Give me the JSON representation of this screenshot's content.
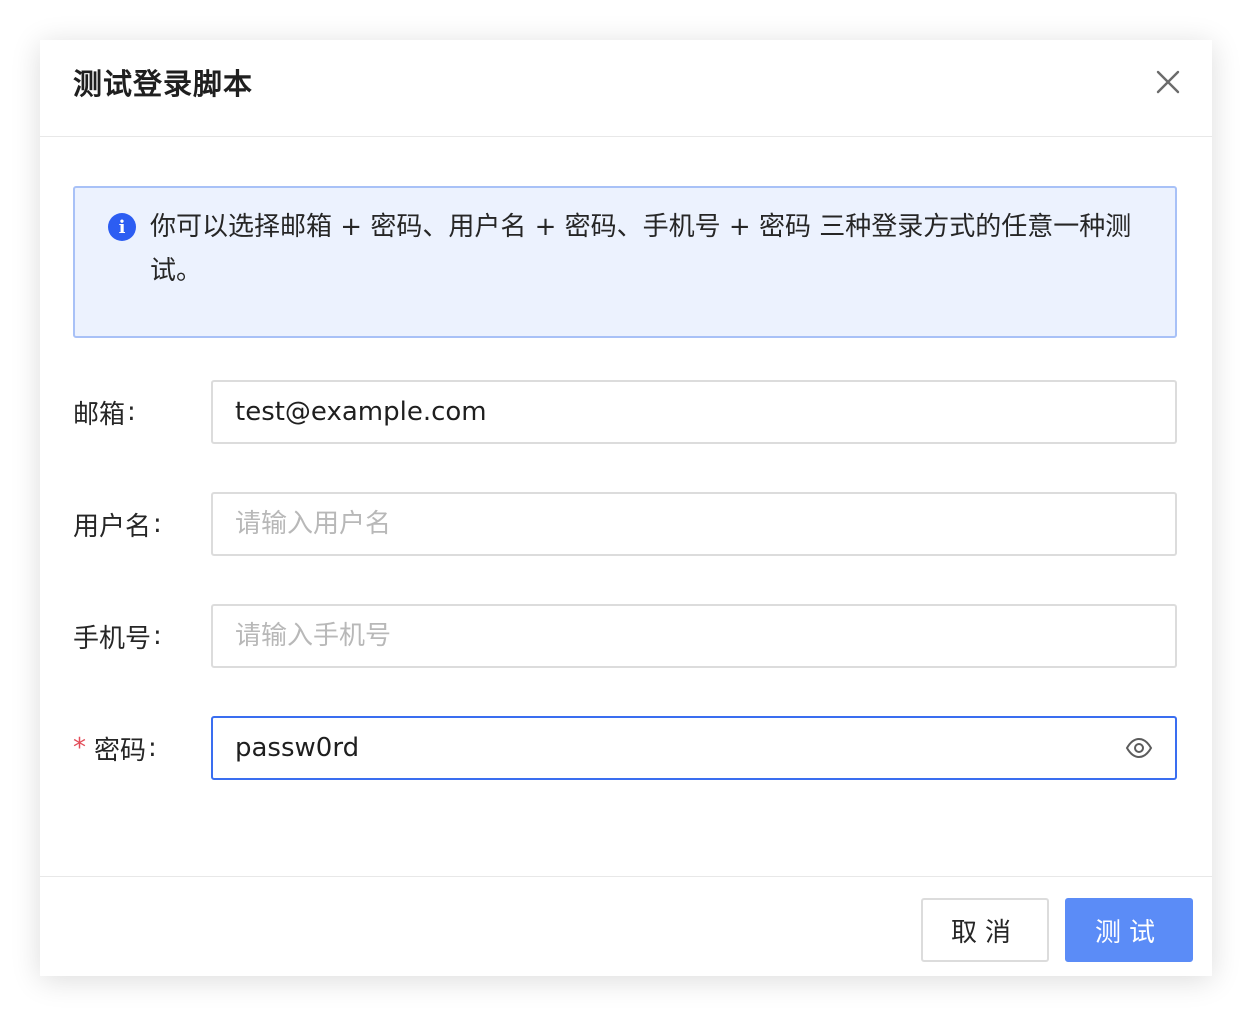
{
  "dialog": {
    "title": "测试登录脚本"
  },
  "alert": {
    "text": "你可以选择邮箱 + 密码、用户名 + 密码、手机号 + 密码 三种登录方式的任意一种测试。",
    "icon": "info-icon"
  },
  "form": {
    "email": {
      "label": "邮箱",
      "value": "test@example.com",
      "placeholder": ""
    },
    "username": {
      "label": "用户名",
      "value": "",
      "placeholder": "请输入用户名"
    },
    "phone": {
      "label": "手机号",
      "value": "",
      "placeholder": "请输入手机号"
    },
    "password": {
      "label": "密码",
      "value": "passw0rd",
      "placeholder": "",
      "required_mark": "*"
    },
    "colon": ":"
  },
  "footer": {
    "cancel_label": "取消",
    "test_label": "测试"
  },
  "colors": {
    "primary": "#5b8cf7",
    "focus_border": "#3a6ef0",
    "alert_bg": "#ecf2fe",
    "alert_border": "#a8c1f7",
    "required": "#e34d59"
  }
}
